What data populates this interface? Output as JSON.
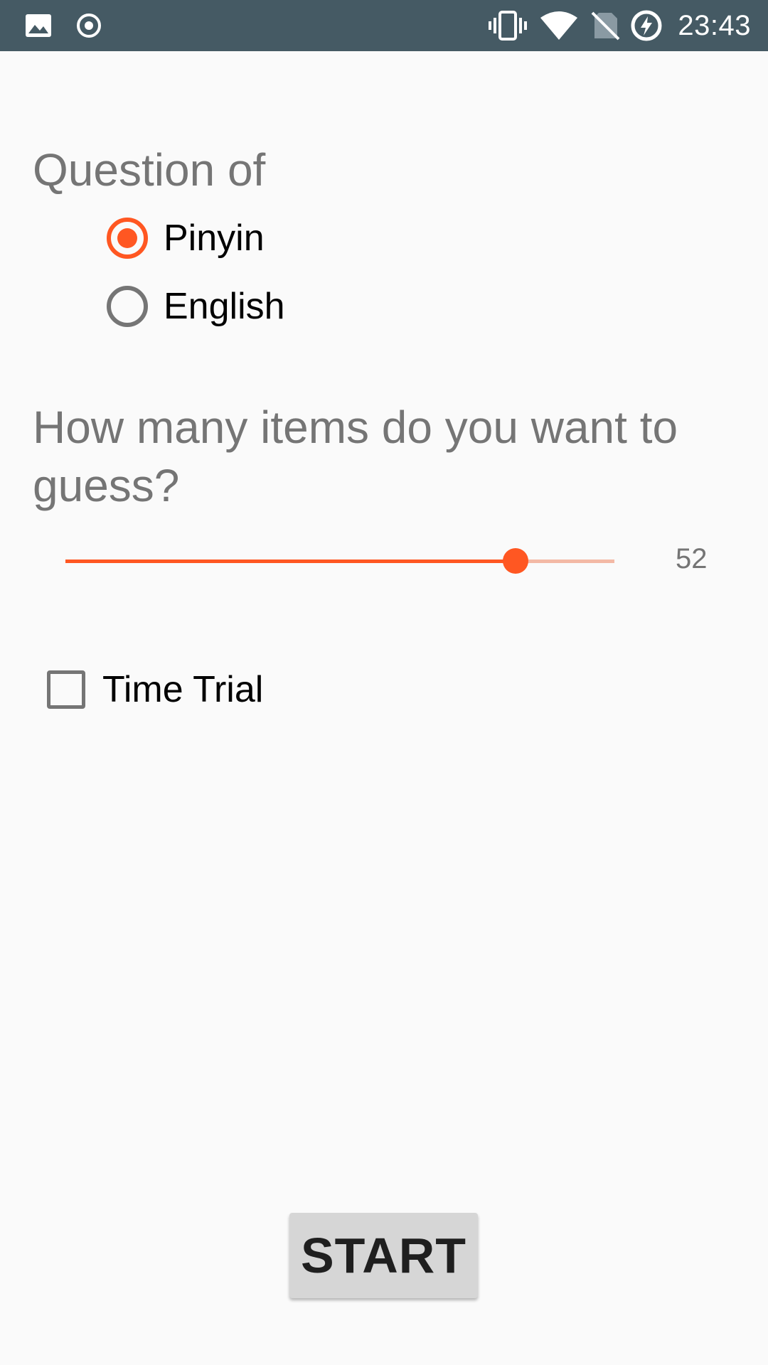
{
  "status_bar": {
    "time": "23:43",
    "icons": [
      "gallery-icon",
      "record-icon",
      "vibrate-icon",
      "wifi-icon",
      "no-sim-icon",
      "battery-charging-icon"
    ]
  },
  "question_section": {
    "title": "Question of",
    "options": [
      {
        "label": "Pinyin",
        "checked": true
      },
      {
        "label": "English",
        "checked": false
      }
    ]
  },
  "items_section": {
    "title": "How many items do you want to guess?",
    "slider_value": "52",
    "slider_fraction": 0.82
  },
  "time_trial": {
    "label": "Time Trial",
    "checked": false
  },
  "start_button": {
    "label": "START"
  },
  "colors": {
    "accent": "#ff5722",
    "status_bar": "#455a64",
    "background": "#fafafa",
    "secondary_text": "#757575"
  }
}
